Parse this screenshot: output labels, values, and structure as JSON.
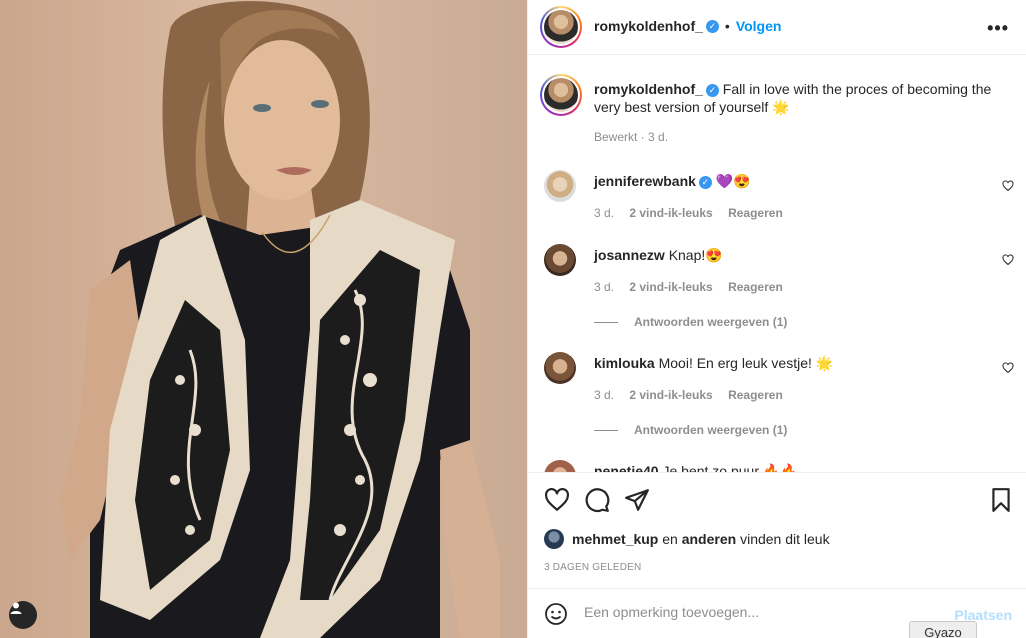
{
  "post": {
    "username": "romykoldenhof_",
    "follow_label": "Volgen",
    "caption": "Fall in love with the proces of becoming the very best version of yourself 🌟",
    "caption_meta": "Bewerkt · 3 d."
  },
  "comments": [
    {
      "username": "jenniferewbank",
      "verified": true,
      "text": "💜😍",
      "time": "3 d.",
      "likes": "2 vind-ik-leuks",
      "reply": "Reageren",
      "replies_label": ""
    },
    {
      "username": "josannezw",
      "verified": false,
      "text": "Knap!😍",
      "time": "3 d.",
      "likes": "2 vind-ik-leuks",
      "reply": "Reageren",
      "replies_label": "Antwoorden weergeven (1)"
    },
    {
      "username": "kimlouka",
      "verified": false,
      "text": "Mooi! En erg leuk vestje! 🌟",
      "time": "3 d.",
      "likes": "2 vind-ik-leuks",
      "reply": "Reageren",
      "replies_label": "Antwoorden weergeven (1)"
    },
    {
      "username": "nenetie40",
      "verified": false,
      "text": "Je bent zo puur 🔥🔥",
      "time": "",
      "likes": "",
      "reply": "",
      "replies_label": ""
    }
  ],
  "likes": {
    "first_user": "mehmet_kup",
    "connector": "en",
    "others": "anderen",
    "suffix": "vinden dit leuk"
  },
  "date_label": "3 DAGEN GELEDEN",
  "add_comment": {
    "placeholder": "Een opmerking toevoegen...",
    "post_label": "Plaatsen"
  },
  "gyazo_label": "Gyazo",
  "icons": {
    "more": "more-options-icon",
    "verified": "verified-badge-icon",
    "like": "heart-icon",
    "comment": "comment-icon",
    "share": "share-icon",
    "save": "bookmark-icon",
    "emoji": "emoji-icon",
    "tag": "user-tag-icon"
  },
  "colors": {
    "accent": "#0095f6",
    "verified": "#3897f0",
    "muted": "#8e8e8e",
    "text": "#262626"
  }
}
